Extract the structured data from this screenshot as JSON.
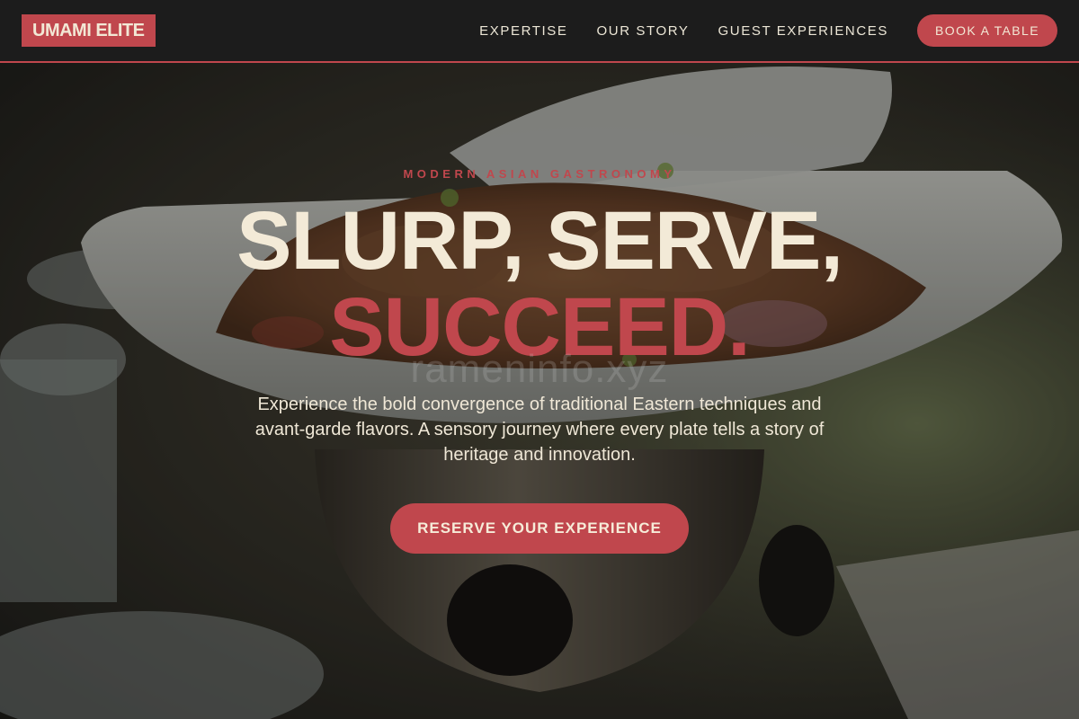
{
  "brand": {
    "logo_text": "UMAMI ELITE",
    "accent_color": "#c0474d",
    "cream_color": "#f3ead7"
  },
  "nav": {
    "links": [
      {
        "label": "EXPERTISE"
      },
      {
        "label": "OUR STORY"
      },
      {
        "label": "GUEST EXPERIENCES"
      }
    ],
    "cta_label": "BOOK A TABLE"
  },
  "hero": {
    "eyebrow": "MODERN ASIAN GASTRONOMY",
    "headline_line1": "SLURP, SERVE,",
    "headline_line2": "SUCCEED.",
    "watermark": "rameninfo.xyz",
    "subtext": "Experience the bold convergence of traditional Eastern techniques and avant-garde flavors. A sensory journey where every plate tells a story of heritage and innovation.",
    "cta_label": "RESERVE YOUR EXPERIENCE",
    "background_image": "food-dish-photo"
  }
}
